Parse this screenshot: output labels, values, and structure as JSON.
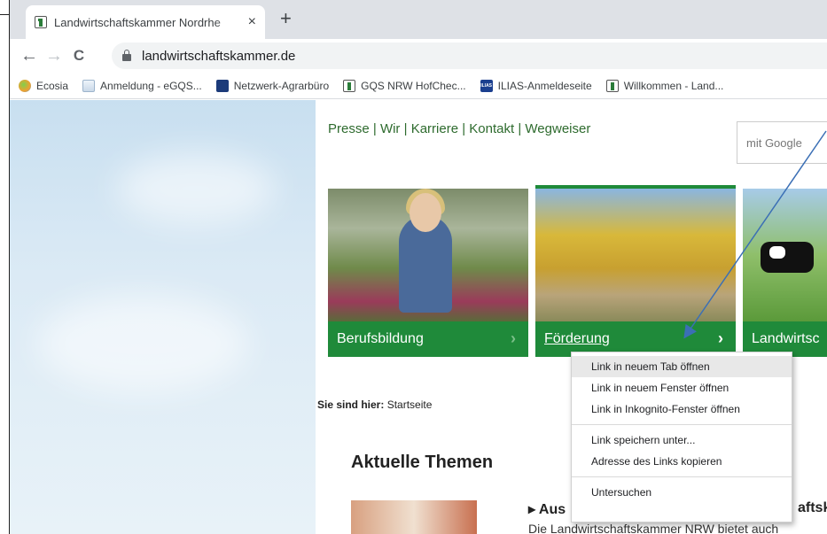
{
  "browser": {
    "tab": {
      "title": "Landwirtschaftskammer Nordrhe",
      "close": "×"
    },
    "new_tab": "+",
    "nav": {
      "back": "←",
      "forward": "→",
      "reload": "C"
    },
    "url": "landwirtschaftskammer.de",
    "bookmarks": [
      {
        "label": "Ecosia",
        "icon": "ecosia-icon"
      },
      {
        "label": "Anmeldung - eGQS...",
        "icon": "document-icon"
      },
      {
        "label": "Netzwerk-Agrarbüro",
        "icon": "netzwerk-icon"
      },
      {
        "label": "GQS NRW HofChec...",
        "icon": "lwk-icon"
      },
      {
        "label": "ILIAS-Anmeldeseite",
        "icon": "ilias-icon",
        "icon_text": "ILIAS"
      },
      {
        "label": "Willkommen - Land...",
        "icon": "lwk-icon"
      }
    ]
  },
  "page": {
    "top_nav": [
      "Presse",
      "Wir",
      "Karriere",
      "Kontakt",
      "Wegweiser"
    ],
    "nav_separator": "|",
    "search_placeholder": "mit Google",
    "tiles": [
      {
        "label": "Berufsbildung",
        "chevron": "›"
      },
      {
        "label": "Förderung",
        "chevron": "›"
      },
      {
        "label": "Landwirtsc",
        "chevron": ""
      }
    ],
    "breadcrumb": {
      "prefix": "Sie sind hier:",
      "current": "Startseite"
    },
    "section_title": "Aktuelle Themen",
    "news": {
      "headline": "▸ Aus",
      "headline_tail": "aftsk",
      "text": "Die Landwirtschaftskammer NRW bietet auch"
    }
  },
  "context_menu": {
    "groups": [
      [
        "Link in neuem Tab öffnen",
        "Link in neuem Fenster öffnen",
        "Link in Inkognito-Fenster öffnen"
      ],
      [
        "Link speichern unter...",
        "Adresse des Links kopieren"
      ],
      [
        "Untersuchen"
      ]
    ],
    "highlighted": "Link in neuem Tab öffnen"
  },
  "colors": {
    "brand_green": "#1f8a3a",
    "link_green": "#2e6b2e",
    "arrow_blue": "#3b6fb5"
  }
}
